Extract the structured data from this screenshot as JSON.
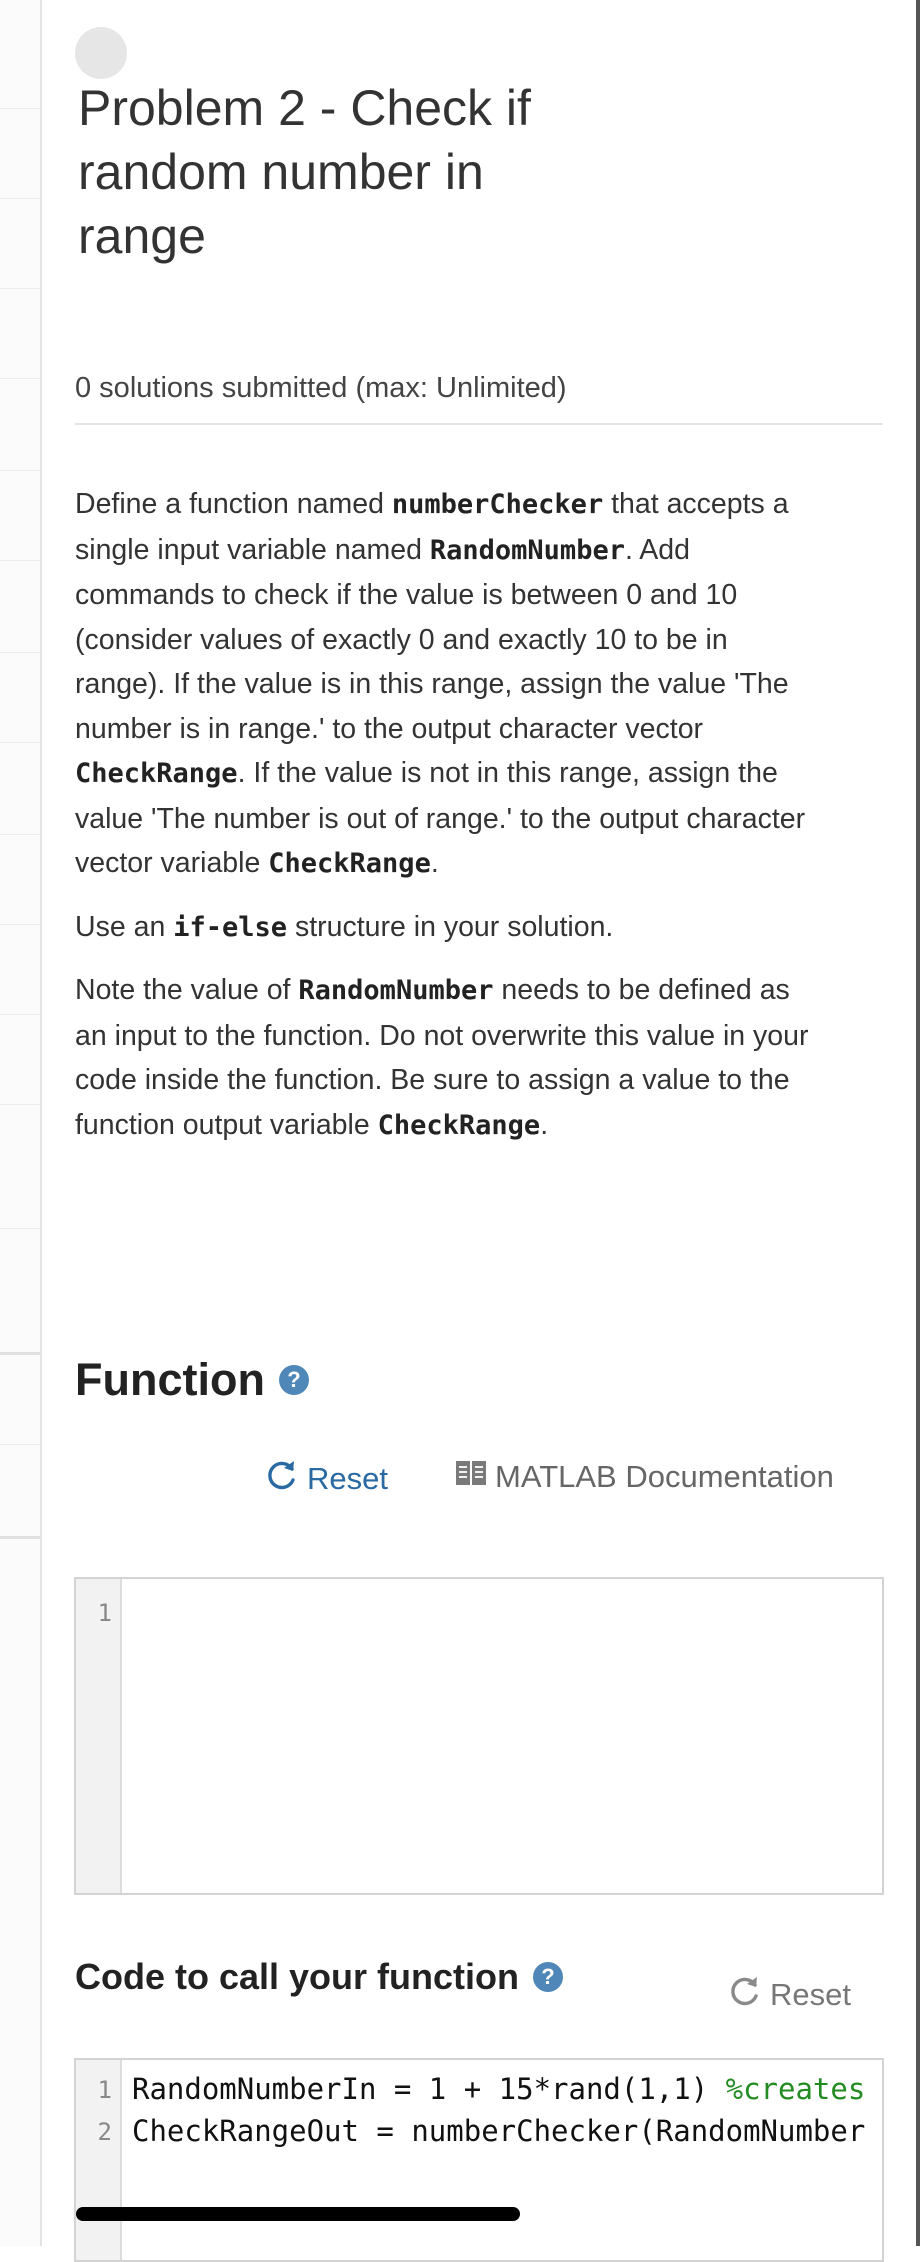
{
  "problem": {
    "title": "Problem 2 - Check if random number in range",
    "status": "0 solutions submitted (max: Unlimited)"
  },
  "description": {
    "p1": {
      "t1": "Define a function named ",
      "c1": "numberChecker",
      "t2": " that accepts a single input variable named ",
      "c2": "RandomNumber",
      "t3": ".  Add commands to check if the value is between 0 and 10 (consider values of exactly 0 and exactly 10 to be in range). If the value is in this range, assign the value 'The number is in range.' to the output character vector ",
      "c3": "CheckRange",
      "t4": ". If the value is not in this range, assign the value 'The number is out of range.' to the output character vector variable ",
      "c4": "CheckRange",
      "t5": "."
    },
    "p2": {
      "t1": "Use an ",
      "c1": "if-else",
      "t2": " structure in your solution."
    },
    "p3": {
      "t1": "Note the value of ",
      "c1": "RandomNumber",
      "t2": "  needs to be defined as an input to the function.  Do not overwrite this value in your code inside the function.  Be sure to assign a value to the function output variable ",
      "c2": "CheckRange",
      "t3": "."
    }
  },
  "function_section": {
    "heading": "Function",
    "help": "?",
    "reset_label": "Reset",
    "docs_label": "MATLAB Documentation",
    "line_numbers": [
      "1"
    ]
  },
  "call_section": {
    "heading": "Code to call your function",
    "help": "?",
    "reset_label": "Reset",
    "line_numbers": [
      "1",
      "2"
    ],
    "lines": [
      {
        "code": "RandomNumberIn = 1 + 15*rand(1,1) ",
        "comment": "%creates"
      },
      {
        "code": "CheckRangeOut = numberChecker(RandomNumber",
        "comment": ""
      }
    ]
  },
  "colors": {
    "accent_blue": "#2a6aa3",
    "help_blue": "#4f88b8",
    "comment_green": "#228b22"
  },
  "icons": {
    "reset": "refresh-icon",
    "docs": "book-icon",
    "help": "help-icon"
  }
}
